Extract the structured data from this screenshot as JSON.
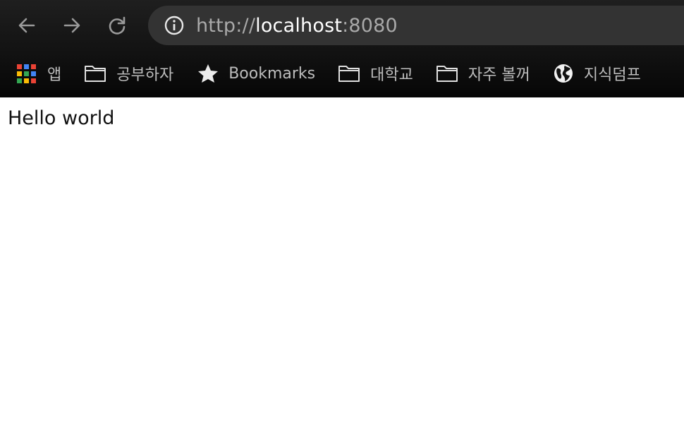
{
  "browser": {
    "nav": {
      "back_icon": "arrow-left-icon",
      "forward_icon": "arrow-right-icon",
      "reload_icon": "reload-icon"
    },
    "address_bar": {
      "scheme": "http://",
      "host": "localhost",
      "port": ":8080",
      "info_icon": "info-circle-icon"
    },
    "bookmarks": [
      {
        "label": "앱",
        "icon": "apps-grid-icon"
      },
      {
        "label": "공부하자",
        "icon": "folder-icon"
      },
      {
        "label": "Bookmarks",
        "icon": "star-icon"
      },
      {
        "label": "대학교",
        "icon": "folder-icon"
      },
      {
        "label": "자주 볼꺼",
        "icon": "folder-icon"
      },
      {
        "label": "지식덤프",
        "icon": "globe-icon"
      }
    ]
  },
  "page": {
    "body_text": "Hello world"
  },
  "colors": {
    "chrome_bg": "#131313",
    "omnibox_bg": "#333333",
    "url_dim": "#a9a9a9",
    "url_host": "#ffffff",
    "bookmark_text": "#bdbdbd",
    "apps_grid": [
      "#ea4335",
      "#4285f4",
      "#fbbc05",
      "#34a853"
    ]
  }
}
